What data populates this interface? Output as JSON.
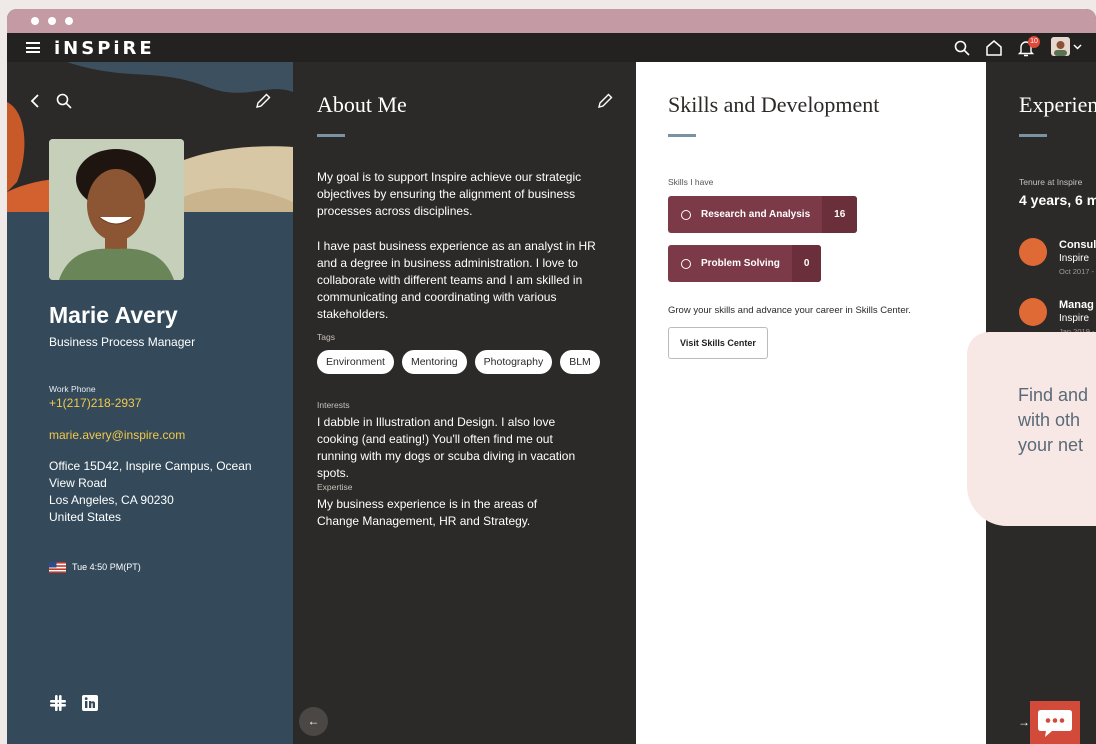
{
  "app": {
    "brand": "iNSPiRE",
    "notification_count": "10"
  },
  "profile": {
    "name": "Marie Avery",
    "role": "Business Process Manager",
    "work_phone_label": "Work Phone",
    "work_phone": "+1(217)218-2937",
    "email": "marie.avery@inspire.com",
    "address_lines": [
      "Office 15D42, Inspire Campus, Ocean",
      "View Road",
      "Los Angeles, CA 90230",
      "United States"
    ],
    "local_time": "Tue 4:50 PM(PT)"
  },
  "about": {
    "title": "About Me",
    "paragraph_1": "My goal is to support Inspire achieve our strategic objectives by ensuring the alignment of business processes across disciplines.",
    "paragraph_2": "I have past business experience as an analyst in HR and a degree in business administration.  I love to collaborate with different teams and I am skilled in communicating and coordinating with various stakeholders.",
    "tags_label": "Tags",
    "tags": [
      "Environment",
      "Mentoring",
      "Photography",
      "BLM"
    ],
    "interests_label": "Interests",
    "interests": "I dabble in Illustration and Design. I also love cooking (and eating!) You'll often find me out running with my dogs or scuba diving in vacation spots.",
    "expertise_label": "Expertise",
    "expertise": "My business experience is in the areas of Change Management, HR and Strategy."
  },
  "skills": {
    "title": "Skills and Development",
    "skills_label": "Skills I have",
    "items": [
      {
        "name": "Research and Analysis",
        "count": "16"
      },
      {
        "name": "Problem Solving",
        "count": "0"
      }
    ],
    "prompt": "Grow your skills and advance your career in Skills Center.",
    "visit_button": "Visit Skills Center"
  },
  "experience": {
    "title": "Experien",
    "tenure_label": "Tenure at Inspire",
    "tenure": "4 years, 6 m",
    "jobs": [
      {
        "title": "Consul",
        "org": "Inspire",
        "date": "Oct 2017 -"
      },
      {
        "title": "Manag",
        "org": "Inspire",
        "date": "Jan 2019 -"
      }
    ]
  },
  "callout": {
    "lines": [
      "Find and",
      "with oth",
      "your net"
    ]
  },
  "colors": {
    "accent": "#7c3a48",
    "link": "#f2c94c",
    "profile_bg": "#344a5a",
    "titlebar": "#c49aa5"
  }
}
